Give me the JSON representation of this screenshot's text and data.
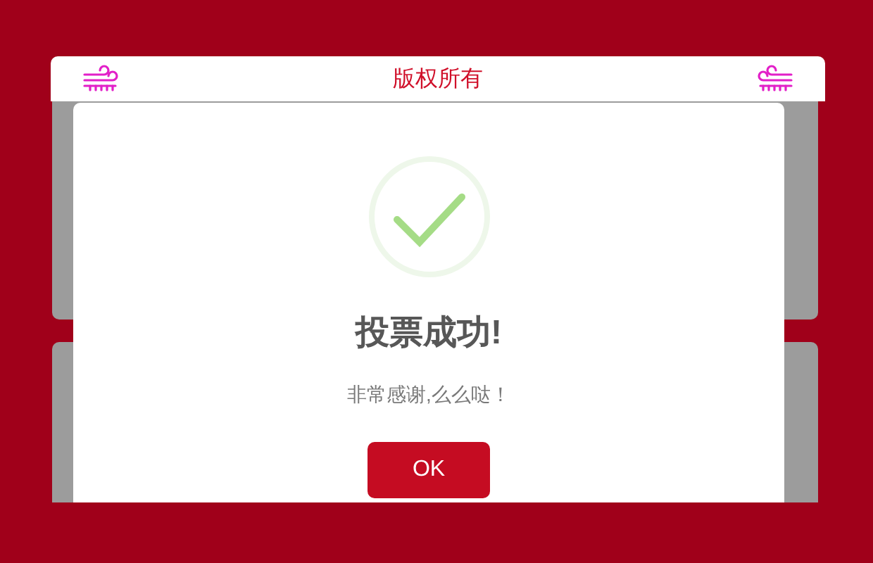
{
  "header": {
    "title": "版权所有"
  },
  "dialog": {
    "title": "投票成功!",
    "message": "非常感谢,么么哒！",
    "buttons": [
      "OK"
    ]
  }
}
